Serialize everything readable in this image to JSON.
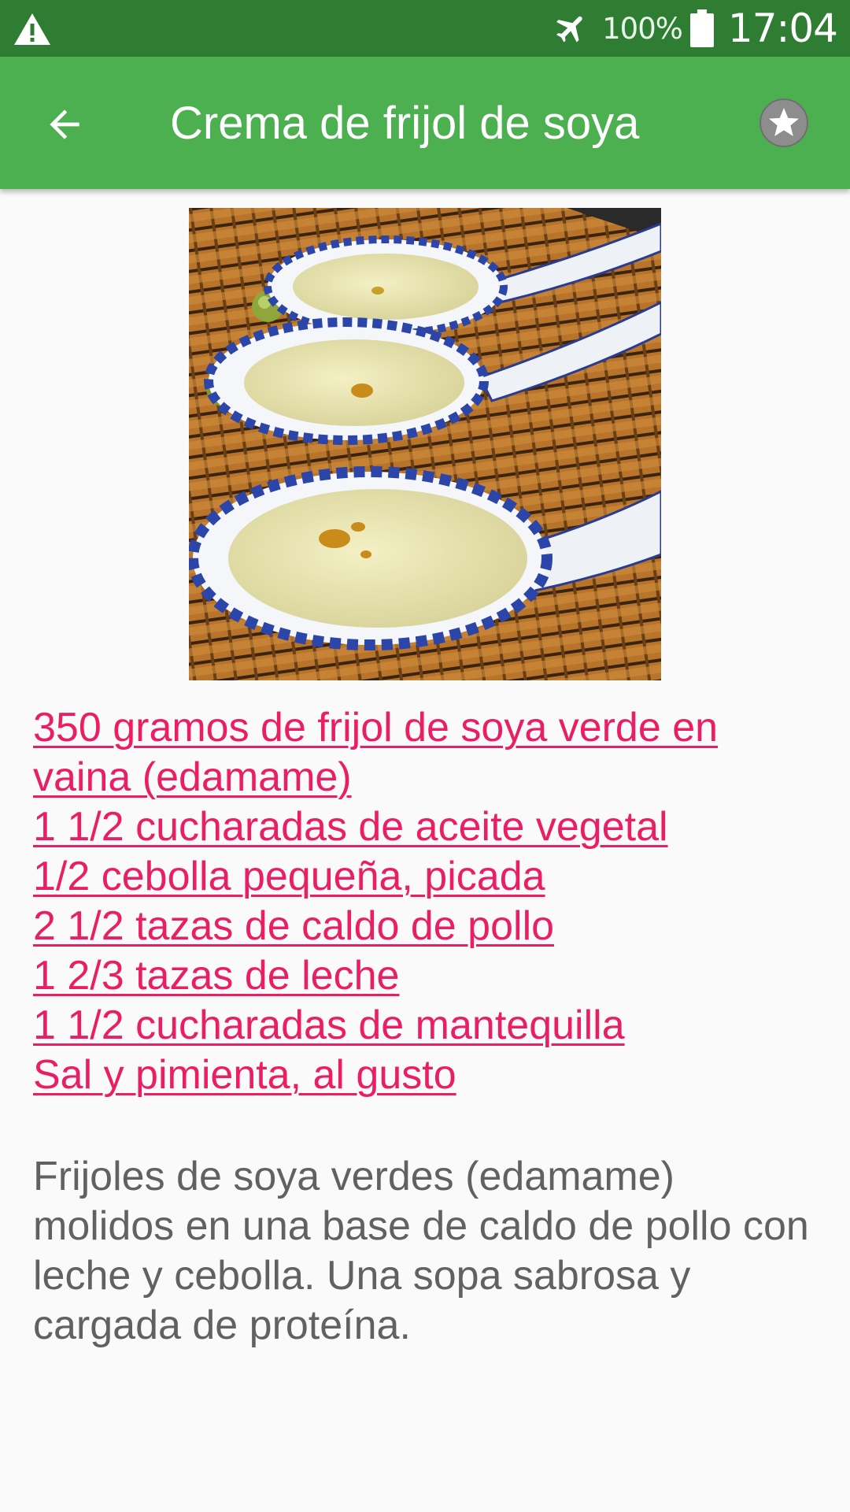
{
  "status_bar": {
    "battery_percent": "100%",
    "time": "17:04",
    "icons": [
      "warning-icon",
      "airplane-mode-icon",
      "battery-icon"
    ]
  },
  "app_bar": {
    "title": "Crema de frijol de soya",
    "back_icon": "arrow-back-icon",
    "favorite_icon": "star-icon",
    "colors": {
      "status": "#2e7d32",
      "toolbar": "#4caf50"
    }
  },
  "recipe": {
    "image_subject": "soup-spoons-photo",
    "ingredients": [
      "350 gramos de frijol de soya verde en vaina (edamame)",
      "1 1/2 cucharadas de aceite vegetal",
      "1/2 cebolla pequeña, picada",
      "2 1/2 tazas de caldo de pollo",
      "1 2/3 tazas de leche",
      "1 1/2 cucharadas de mantequilla",
      "Sal y pimienta, al gusto"
    ],
    "description": "Frijoles de soya verdes (edamame) molidos en una base de caldo de pollo con leche y cebolla. Una sopa sabrosa y cargada de proteína.",
    "link_color": "#e91e63",
    "text_color": "#616161"
  }
}
